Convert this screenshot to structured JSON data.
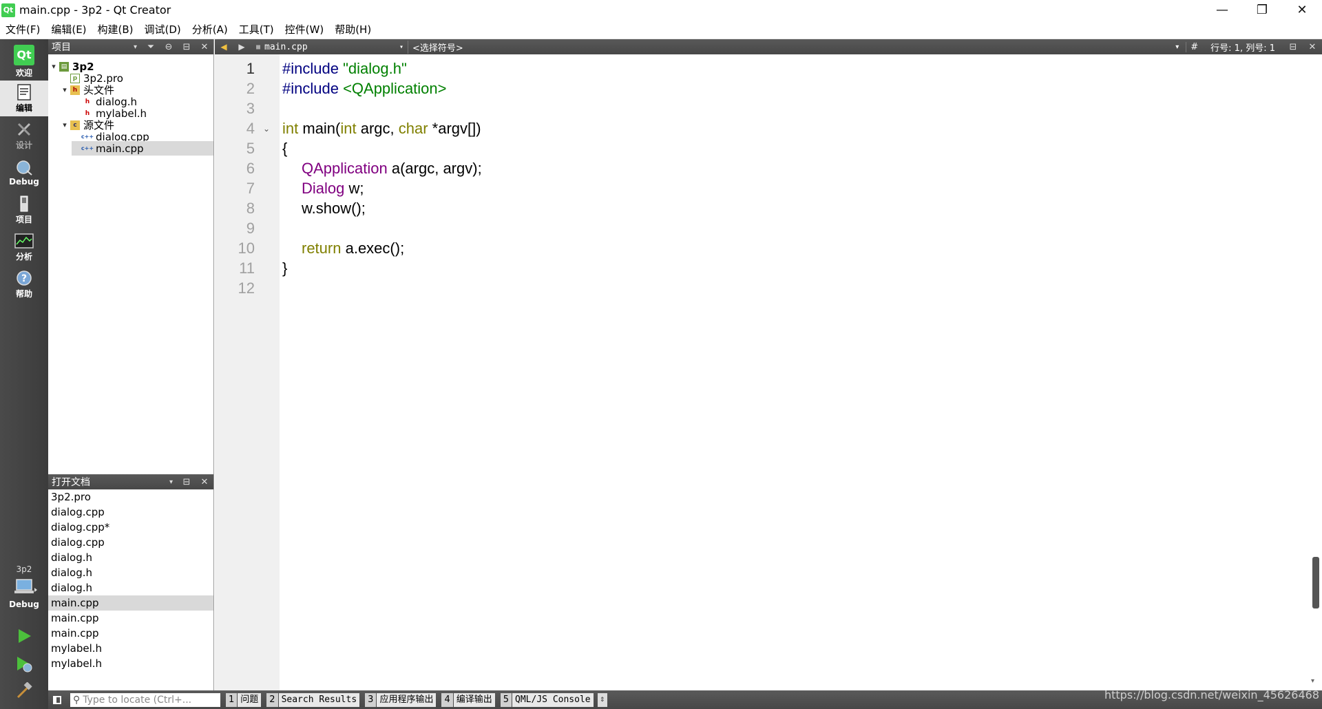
{
  "window": {
    "title": "main.cpp - 3p2 - Qt Creator",
    "app_icon_text": "Qt",
    "controls": {
      "minimize": "—",
      "maximize": "❐",
      "close": "✕"
    }
  },
  "menubar": [
    "文件(F)",
    "编辑(E)",
    "构建(B)",
    "调试(D)",
    "分析(A)",
    "工具(T)",
    "控件(W)",
    "帮助(H)"
  ],
  "modebar": {
    "modes": [
      {
        "label": "欢迎",
        "icon": "qt-logo-icon"
      },
      {
        "label": "编辑",
        "icon": "edit-document-icon",
        "active": true
      },
      {
        "label": "设计",
        "icon": "design-pen-icon"
      },
      {
        "label": "Debug",
        "icon": "debug-bug-icon"
      },
      {
        "label": "项目",
        "icon": "project-wrench-icon"
      },
      {
        "label": "分析",
        "icon": "analyze-chart-icon"
      },
      {
        "label": "帮助",
        "icon": "help-question-icon"
      }
    ],
    "kit": {
      "project": "3p2",
      "mode": "Debug"
    }
  },
  "project_pane": {
    "title": "项目",
    "tree": [
      {
        "label": "3p2",
        "level": 0,
        "expanded": true,
        "icon": "project-icon",
        "bold": true
      },
      {
        "label": "3p2.pro",
        "level": 1,
        "icon": "pro-file-icon"
      },
      {
        "label": "头文件",
        "level": 1,
        "expanded": true,
        "icon": "folder-icon"
      },
      {
        "label": "dialog.h",
        "level": 2,
        "icon": "header-file-icon"
      },
      {
        "label": "mylabel.h",
        "level": 2,
        "icon": "header-file-icon"
      },
      {
        "label": "源文件",
        "level": 1,
        "expanded": true,
        "icon": "folder-icon"
      },
      {
        "label": "dialog.cpp",
        "level": 2,
        "icon": "cpp-file-icon"
      },
      {
        "label": "main.cpp",
        "level": 2,
        "icon": "cpp-file-icon",
        "selected": true
      }
    ]
  },
  "docs_pane": {
    "title": "打开文档",
    "docs": [
      {
        "label": "3p2.pro"
      },
      {
        "label": "dialog.cpp"
      },
      {
        "label": "dialog.cpp*"
      },
      {
        "label": "dialog.cpp"
      },
      {
        "label": "dialog.h"
      },
      {
        "label": "dialog.h"
      },
      {
        "label": "dialog.h"
      },
      {
        "label": "main.cpp",
        "selected": true
      },
      {
        "label": "main.cpp"
      },
      {
        "label": "main.cpp"
      },
      {
        "label": "mylabel.h"
      },
      {
        "label": "mylabel.h"
      }
    ]
  },
  "editor_toolbar": {
    "file": "main.cpp",
    "symbol": "<选择符号>",
    "hash": "#",
    "position": "行号: 1, 列号: 1"
  },
  "editor": {
    "current_line": 1,
    "lines": [
      {
        "n": "1",
        "text": ""
      },
      {
        "n": "2",
        "text": ""
      },
      {
        "n": "3",
        "text": ""
      },
      {
        "n": "4",
        "text": "",
        "fold": true
      },
      {
        "n": "5",
        "text": ""
      },
      {
        "n": "6",
        "text": ""
      },
      {
        "n": "7",
        "text": ""
      },
      {
        "n": "8",
        "text": ""
      },
      {
        "n": "9",
        "text": ""
      },
      {
        "n": "10",
        "text": ""
      },
      {
        "n": "11",
        "text": ""
      },
      {
        "n": "12",
        "text": ""
      }
    ],
    "code": {
      "l1_a": "#include",
      "l1_b": " \"dialog.h\"",
      "l2_a": "#include",
      "l2_b": " <QApplication>",
      "l4_a": "int",
      "l4_b": " main(",
      "l4_c": "int",
      "l4_d": " argc, ",
      "l4_e": "char",
      "l4_f": " *argv[])",
      "l5": "{",
      "l6_a": "QApplication",
      "l6_b": " a(argc, argv);",
      "l7_a": "Dialog",
      "l7_b": " w;",
      "l8": "w.show();",
      "l10_a": "return",
      "l10_b": " a.exec();",
      "l11": "}"
    }
  },
  "statusbar": {
    "locator_placeholder": "Type to locate (Ctrl+...",
    "tabs": [
      {
        "num": "1",
        "label": "问题"
      },
      {
        "num": "2",
        "label": "Search Results"
      },
      {
        "num": "3",
        "label": "应用程序输出"
      },
      {
        "num": "4",
        "label": "编译输出"
      },
      {
        "num": "5",
        "label": "QML/JS Console"
      }
    ]
  },
  "watermark": "https://blog.csdn.net/weixin_45626468"
}
